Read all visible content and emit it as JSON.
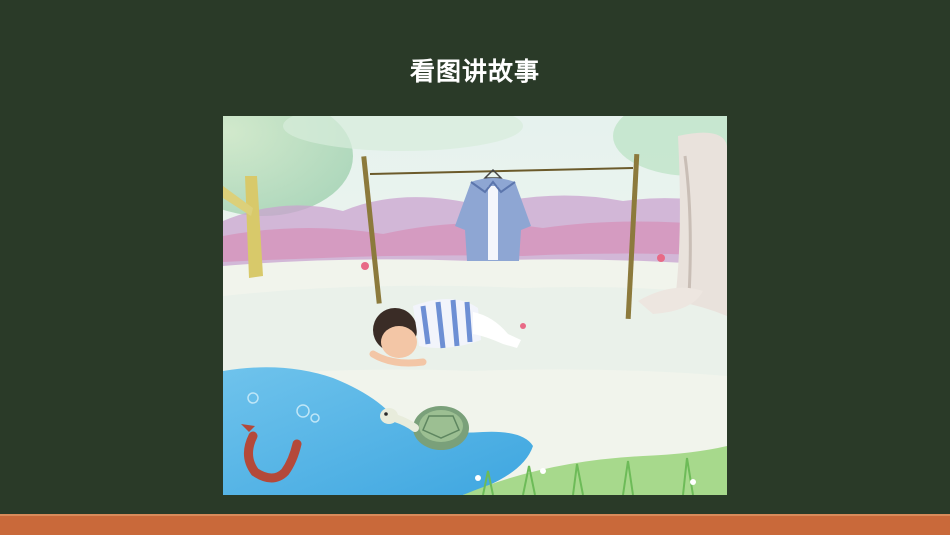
{
  "slide": {
    "title": "看图讲故事",
    "illustration": {
      "scene": "boy-turtle-fish-story-illustration"
    }
  },
  "colors": {
    "background": "#2a3a28",
    "title_text": "#ffffff",
    "bottom_bar": "#c9693a",
    "bottom_line": "#d98a5a"
  }
}
